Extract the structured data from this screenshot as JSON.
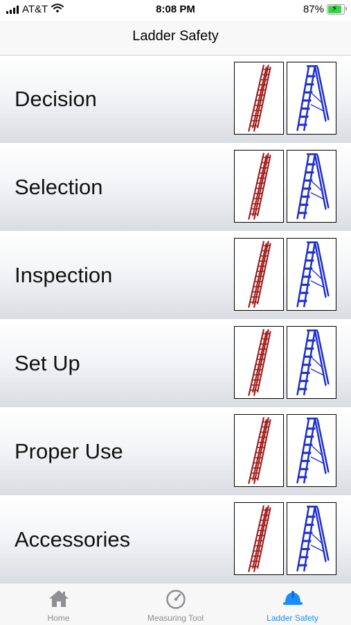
{
  "status_bar": {
    "carrier": "AT&T",
    "time": "8:08 PM",
    "battery_percent": "87%",
    "battery_level": 0.87,
    "icons": [
      "signal-icon",
      "wifi-icon",
      "battery-charging-icon"
    ]
  },
  "nav": {
    "title": "Ladder Safety"
  },
  "menu": {
    "items": [
      {
        "label": "Decision"
      },
      {
        "label": "Selection"
      },
      {
        "label": "Inspection"
      },
      {
        "label": "Set Up"
      },
      {
        "label": "Proper Use"
      },
      {
        "label": "Accessories"
      }
    ],
    "thumbnail_icons": [
      "extension-ladder-icon",
      "step-ladder-icon"
    ]
  },
  "tab_bar": {
    "tabs": [
      {
        "label": "Home",
        "icon": "home-icon",
        "active": false
      },
      {
        "label": "Measuring Tool",
        "icon": "gauge-icon",
        "active": false
      },
      {
        "label": "Ladder Safety",
        "icon": "hard-hat-icon",
        "active": true
      }
    ]
  },
  "colors": {
    "accent": "#1a8cff",
    "extension_ladder": "#a01a1a",
    "step_ladder": "#1f2fd0",
    "inactive_tab": "#8e8e93"
  }
}
